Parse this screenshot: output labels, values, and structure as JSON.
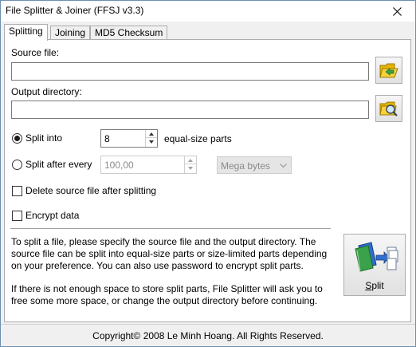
{
  "window": {
    "title": "File Splitter & Joiner (FFSJ v3.3)"
  },
  "tabs": [
    {
      "label": "Splitting",
      "active": true
    },
    {
      "label": "Joining",
      "active": false
    },
    {
      "label": "MD5 Checksum",
      "active": false
    }
  ],
  "source": {
    "label": "Source file:",
    "value": "",
    "browse_icon": "open-folder-icon"
  },
  "output": {
    "label": "Output directory:",
    "value": "",
    "browse_icon": "browse-folder-icon"
  },
  "split_into": {
    "label": "Split into",
    "value": "8",
    "suffix": "equal-size parts",
    "selected": true
  },
  "split_after": {
    "label": "Split after every",
    "value": "100,00",
    "unit": "Mega bytes",
    "selected": false
  },
  "options": {
    "delete_source": {
      "label": "Delete source file after splitting",
      "checked": false
    },
    "encrypt": {
      "label": "Encrypt data",
      "checked": false
    }
  },
  "info": {
    "para1": "To split a file, please specify the source file and the output directory. The source file can be split into equal-size parts or size-limited parts depending on your preference. You can also use password to encrypt split parts.",
    "para2": "If there is not enough space to store split parts, File Splitter will ask you to free some more space, or change the output directory before continuing."
  },
  "split_button": {
    "label": "Split",
    "mnemonic": "S",
    "rest": "plit"
  },
  "status": {
    "text": "Copyright© 2008 Le Minh Hoang. All Rights Reserved."
  },
  "colors": {
    "folder": "#f2c200",
    "book_blue": "#2e6fd0",
    "book_green": "#3aa24a"
  }
}
